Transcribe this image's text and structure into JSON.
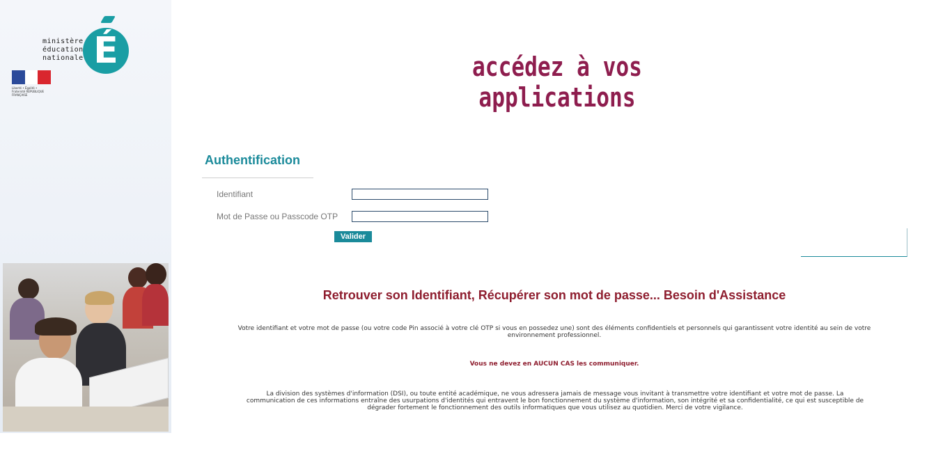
{
  "branding": {
    "logo_lines": [
      "ministère",
      "éducation",
      "nationale"
    ],
    "logo_letter": "É",
    "flag_colors": [
      "#2b4a9a",
      "#ffffff",
      "#d9262e"
    ],
    "republic_text": "Liberté • Égalité • Fraternité RÉPUBLIQUE FRANÇAISE",
    "accent_color": "#1a9ea4"
  },
  "page_title": "accédez à vos applications",
  "auth": {
    "heading": "Authentification",
    "identifiant_label": "Identifiant",
    "identifiant_value": "",
    "password_label": "Mot de Passe ou Passcode OTP",
    "password_value": "",
    "submit_label": "Valider"
  },
  "help": {
    "heading": "Retrouver son Identifiant, Récupérer son mot de passe... Besoin d'Assistance",
    "paragraph1": "Votre identifiant et votre mot de passe (ou votre code Pin associé à votre clé OTP si vous en possedez une) sont des éléments confidentiels et personnels qui garantissent votre identité au sein de votre environnement professionnel.",
    "warning": "Vous ne devez en AUCUN CAS les communiquer.",
    "paragraph2": "La division des systèmes d'information (DSI), ou toute entité académique, ne vous adressera jamais de message vous invitant à transmettre votre identifiant et votre mot de passe. La communication de ces informations entraîne des usurpations d'identités qui entravent le bon fonctionnement du système d'information, son intégrité et sa confidentialité, ce qui est susceptible de dégrader fortement le fonctionnement des outils informatiques que vous utilisez au quotidien. Merci de votre vigilance."
  }
}
